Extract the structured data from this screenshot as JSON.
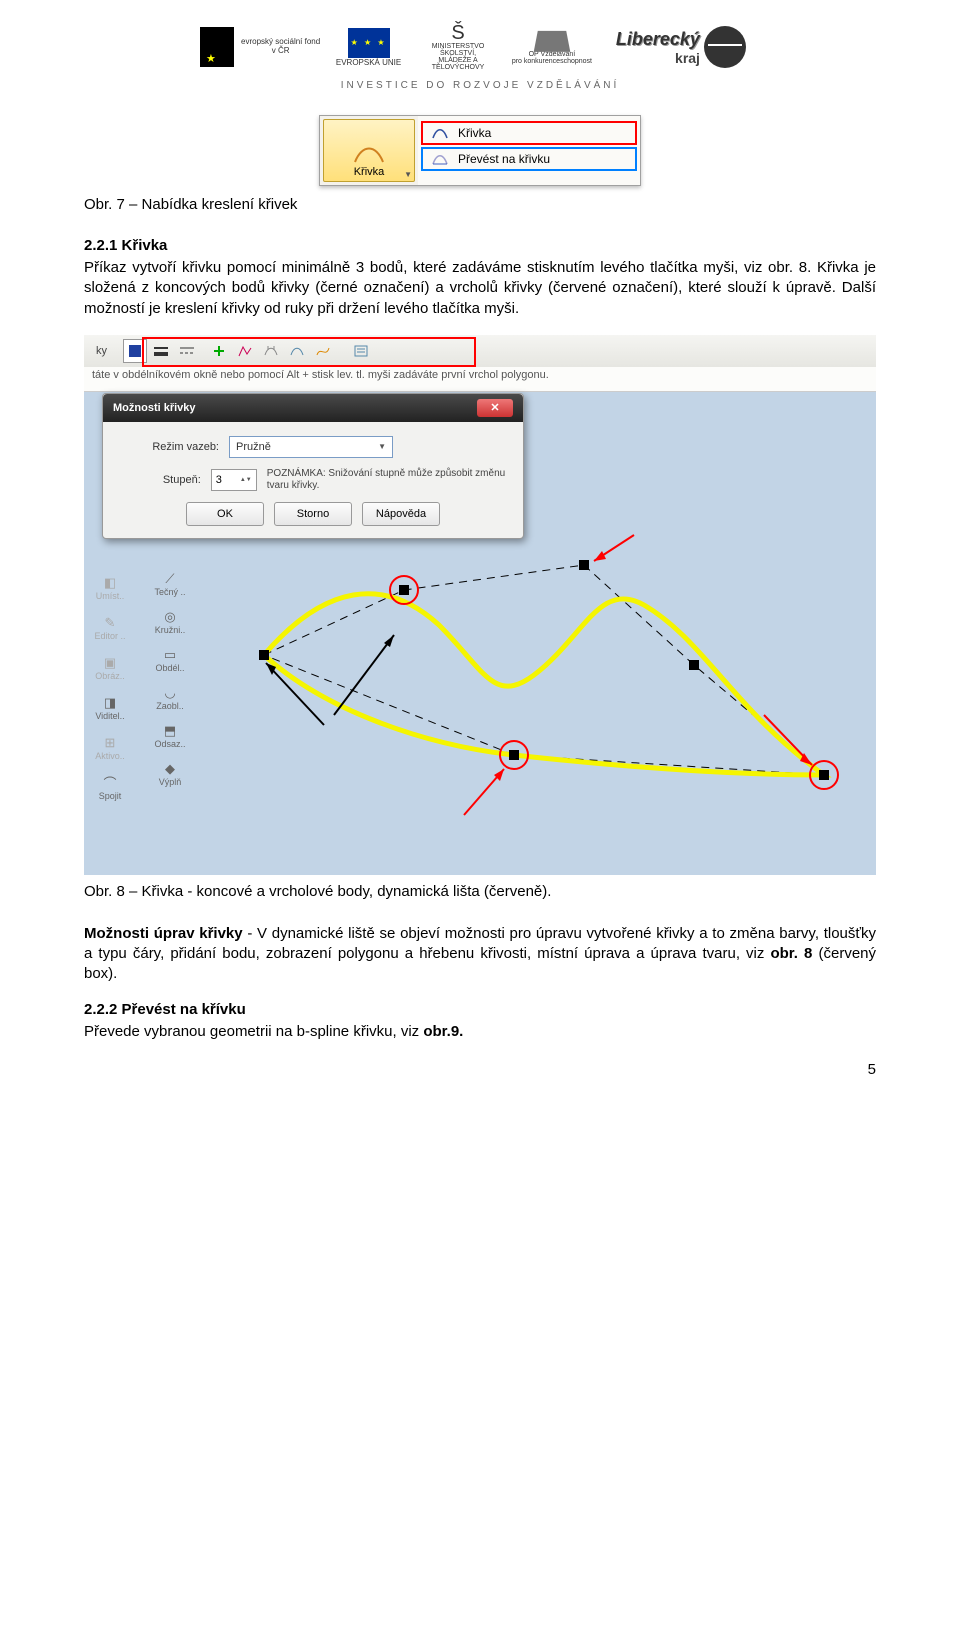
{
  "header": {
    "esf_text": "evropský\nsociální\nfond v ČR",
    "eu_text": "EVROPSKÁ UNIE",
    "msmt_line1": "MINISTERSTVO ŠKOLSTVÍ,",
    "msmt_line2": "MLÁDEŽE A TĚLOVÝCHOVY",
    "op_line1": "OP Vzdělávání",
    "op_line2": "pro konkurenceschopnost",
    "lib_text": "Liberecký",
    "lib_sub": "kraj",
    "tagline": "INVESTICE DO ROZVOJE VZDĚLÁVÁNÍ"
  },
  "menu": {
    "button_label": "Křivka",
    "item1": "Křivka",
    "item2": "Převést na křivku"
  },
  "fig7_caption": "Obr. 7 – Nabídka kreslení křivek",
  "sec221_heading": "2.2.1 Křivka",
  "para1": "Příkaz vytvoří křivku pomocí minimálně 3 bodů, které zadáváme stisknutím levého tlačítka myši, viz obr. 8. Křivka je složená z koncových bodů křivky (černé označení) a vrcholů křivky (červené označení), které slouží k úpravě. Další možností je kreslení křivky od ruky při držení levého tlačítka myši.",
  "figure8": {
    "toolbar_tab": "ky",
    "hint": "táte v obdélníkovém okně nebo pomocí Alt + stisk lev. tl. myši zadáváte první vrchol polygonu.",
    "dialog_title": "Možnosti křivky",
    "label_rezim": "Režim vazeb:",
    "value_rezim": "Pružně",
    "label_stupen": "Stupeň:",
    "value_stupen": "3",
    "note": "POZNÁMKA: Snižování stupně může způsobit  změnu tvaru křivky.",
    "btn_ok": "OK",
    "btn_storno": "Storno",
    "btn_napoveda": "Nápověda",
    "side1": {
      "umist": "Umíst..",
      "editor": "Editor ..",
      "obraz": "Obráz..",
      "viditel": "Viditel..",
      "aktivo": "Aktivo..",
      "spojit": "Spojit"
    },
    "side2": {
      "tecny": "Tečný ..",
      "kruzni": "Kružni..",
      "obdel": "Obdél..",
      "zaobl": "Zaobl..",
      "odsaz": "Odsaz..",
      "vypln": "Výplň"
    }
  },
  "fig8_caption": "Obr. 8 – Křivka - koncové a vrcholové body, dynamická lišta (červeně).",
  "para2_bold": "Možnosti úprav křivky",
  "para2_rest": " - V dynamické liště se objeví možnosti pro úpravu vytvořené křivky a to změna barvy, tloušťky a typu čáry, přidání bodu, zobrazení polygonu a hřebenu křivosti, místní úprava a úprava tvaru, viz ",
  "para2_obr": "obr. 8",
  "para2_tail": " (červený box).",
  "sec222_heading": "2.2.2 Převést na křívku",
  "para3": "Převede vybranou geometrii na b-spline křivku, viz ",
  "para3_obr": "obr.9.",
  "page_number": "5"
}
